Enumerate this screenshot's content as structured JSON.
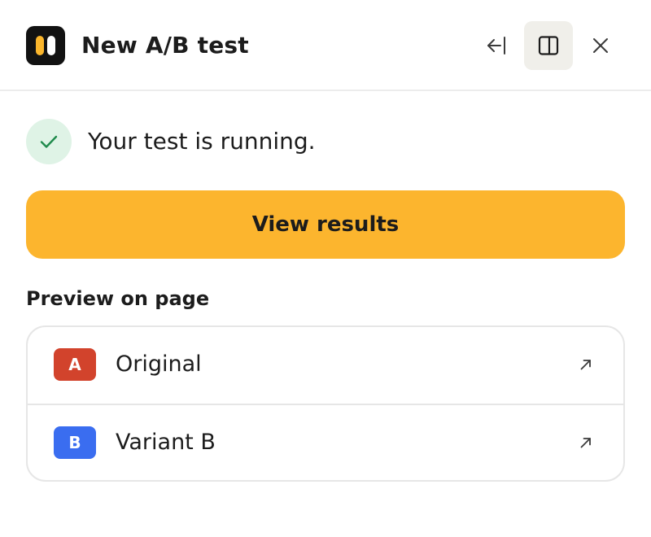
{
  "header": {
    "title": "New A/B test",
    "icons": {
      "logo": "app-logo-icon",
      "collapse": "arrow-left-to-line-icon",
      "panel": "panel-split-icon",
      "close": "close-icon"
    }
  },
  "status": {
    "text": "Your test is running.",
    "icon": "check-icon"
  },
  "primary_action": {
    "label": "View results"
  },
  "preview": {
    "section_label": "Preview on page",
    "variants": [
      {
        "badge": "A",
        "name": "Original",
        "badge_color": "#d2432c",
        "icon": "external-link-arrow-icon"
      },
      {
        "badge": "B",
        "name": "Variant B",
        "badge_color": "#3a6df0",
        "icon": "external-link-arrow-icon"
      }
    ]
  },
  "colors": {
    "accent": "#fcb52e",
    "success_bg": "#dff3e6",
    "success_fg": "#1f8a4c",
    "panel_button_bg": "#f0efea",
    "border": "#e6e6e6"
  }
}
